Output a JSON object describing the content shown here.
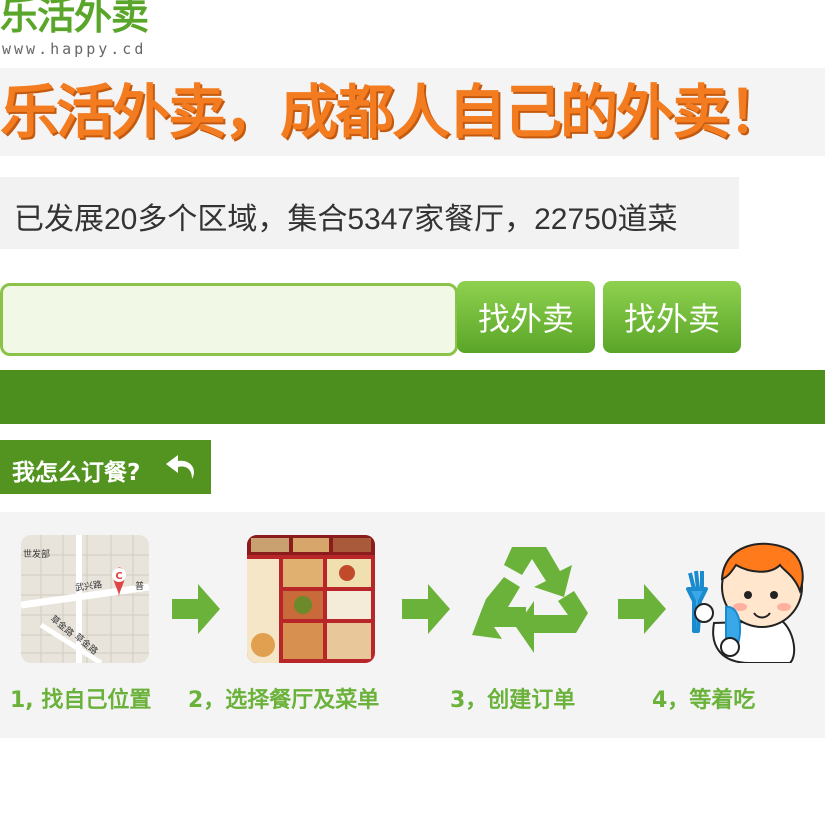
{
  "logo": {
    "text": "乐活外卖",
    "url": "www.happy.cd"
  },
  "banner": {
    "slogan": "乐活外卖，成都人自己的外卖！"
  },
  "stats": {
    "text": "已发展20多个区域，集合5347家餐厅，22750道菜"
  },
  "search": {
    "value": "",
    "placeholder": "",
    "button1": "找外卖",
    "button2": "找外卖"
  },
  "how_to": {
    "title": "我怎么订餐?"
  },
  "steps": [
    {
      "label": "1, 找自己位置"
    },
    {
      "label": "2，选择餐厅及菜单"
    },
    {
      "label": "3，创建订单"
    },
    {
      "label": "4，等着吃"
    }
  ],
  "map": {
    "labels": [
      "世发部",
      "武兴路",
      "草金路",
      "草金路",
      "普"
    ]
  },
  "colors": {
    "brand_green": "#5aa62a",
    "dark_green": "#4d8f1f",
    "orange": "#f47c20"
  }
}
